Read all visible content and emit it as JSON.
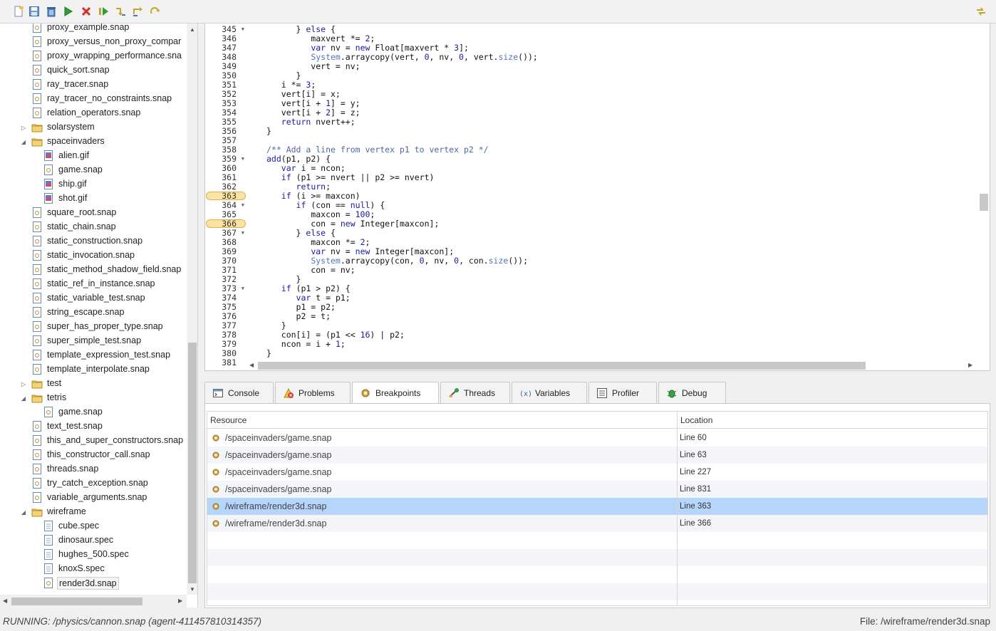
{
  "toolbar": {
    "buttons": [
      "new-file",
      "save",
      "delete",
      "run",
      "stop",
      "resume",
      "step-into",
      "step-over",
      "step-return"
    ],
    "right_button": "perspective"
  },
  "tree": {
    "items": [
      {
        "label": "proxy_example.snap",
        "type": "snap",
        "depth": 1
      },
      {
        "label": "proxy_versus_non_proxy_compar",
        "type": "snap",
        "depth": 1
      },
      {
        "label": "proxy_wrapping_performance.sna",
        "type": "snap",
        "depth": 1
      },
      {
        "label": "quick_sort.snap",
        "type": "snap",
        "depth": 1
      },
      {
        "label": "ray_tracer.snap",
        "type": "snap",
        "depth": 1
      },
      {
        "label": "ray_tracer_no_constraints.snap",
        "type": "snap",
        "depth": 1
      },
      {
        "label": "relation_operators.snap",
        "type": "snap",
        "depth": 1
      },
      {
        "label": "solarsystem",
        "type": "folder",
        "depth": 1,
        "expanded": false
      },
      {
        "label": "spaceinvaders",
        "type": "folder",
        "depth": 1,
        "expanded": true
      },
      {
        "label": "alien.gif",
        "type": "gif",
        "depth": 2
      },
      {
        "label": "game.snap",
        "type": "snap",
        "depth": 2
      },
      {
        "label": "ship.gif",
        "type": "gif",
        "depth": 2
      },
      {
        "label": "shot.gif",
        "type": "gif",
        "depth": 2
      },
      {
        "label": "square_root.snap",
        "type": "snap",
        "depth": 1
      },
      {
        "label": "static_chain.snap",
        "type": "snap",
        "depth": 1
      },
      {
        "label": "static_construction.snap",
        "type": "snap",
        "depth": 1
      },
      {
        "label": "static_invocation.snap",
        "type": "snap",
        "depth": 1
      },
      {
        "label": "static_method_shadow_field.snap",
        "type": "snap",
        "depth": 1
      },
      {
        "label": "static_ref_in_instance.snap",
        "type": "snap",
        "depth": 1
      },
      {
        "label": "static_variable_test.snap",
        "type": "snap",
        "depth": 1
      },
      {
        "label": "string_escape.snap",
        "type": "snap",
        "depth": 1
      },
      {
        "label": "super_has_proper_type.snap",
        "type": "snap",
        "depth": 1
      },
      {
        "label": "super_simple_test.snap",
        "type": "snap",
        "depth": 1
      },
      {
        "label": "template_expression_test.snap",
        "type": "snap",
        "depth": 1
      },
      {
        "label": "template_interpolate.snap",
        "type": "snap",
        "depth": 1
      },
      {
        "label": "test",
        "type": "folder",
        "depth": 1,
        "expanded": false
      },
      {
        "label": "tetris",
        "type": "folder",
        "depth": 1,
        "expanded": true
      },
      {
        "label": "game.snap",
        "type": "snap",
        "depth": 2
      },
      {
        "label": "text_test.snap",
        "type": "snap",
        "depth": 1
      },
      {
        "label": "this_and_super_constructors.snap",
        "type": "snap",
        "depth": 1
      },
      {
        "label": "this_constructor_call.snap",
        "type": "snap",
        "depth": 1
      },
      {
        "label": "threads.snap",
        "type": "snap",
        "depth": 1
      },
      {
        "label": "try_catch_exception.snap",
        "type": "snap",
        "depth": 1
      },
      {
        "label": "variable_arguments.snap",
        "type": "snap",
        "depth": 1
      },
      {
        "label": "wireframe",
        "type": "folder",
        "depth": 1,
        "expanded": true
      },
      {
        "label": "cube.spec",
        "type": "spec",
        "depth": 2
      },
      {
        "label": "dinosaur.spec",
        "type": "spec",
        "depth": 2
      },
      {
        "label": "hughes_500.spec",
        "type": "spec",
        "depth": 2
      },
      {
        "label": "knoxS.spec",
        "type": "spec",
        "depth": 2
      },
      {
        "label": "render3d.snap",
        "type": "snap",
        "depth": 2,
        "selected": true
      }
    ]
  },
  "editor": {
    "lines": [
      {
        "n": "345",
        "fold": true,
        "code": [
          [
            "",
            "      } "
          ],
          [
            "kw",
            "else"
          ],
          [
            "",
            " {"
          ]
        ]
      },
      {
        "n": "346",
        "code": [
          [
            "",
            "         maxvert *= "
          ],
          [
            "num2",
            "2"
          ],
          [
            "",
            ";"
          ]
        ]
      },
      {
        "n": "347",
        "code": [
          [
            "",
            "         "
          ],
          [
            "kw",
            "var"
          ],
          [
            "",
            " nv = "
          ],
          [
            "kw",
            "new"
          ],
          [
            "",
            " Float[maxvert * "
          ],
          [
            "num2",
            "3"
          ],
          [
            "",
            "];"
          ]
        ]
      },
      {
        "n": "348",
        "code": [
          [
            "",
            "         "
          ],
          [
            "sys",
            "System"
          ],
          [
            "",
            ".arraycopy(vert, "
          ],
          [
            "num2",
            "0"
          ],
          [
            "",
            ", nv, "
          ],
          [
            "num2",
            "0"
          ],
          [
            "",
            ", vert."
          ],
          [
            "sys",
            "size"
          ],
          [
            "",
            "());"
          ]
        ]
      },
      {
        "n": "349",
        "code": [
          [
            "",
            "         vert = nv;"
          ]
        ]
      },
      {
        "n": "350",
        "code": [
          [
            "",
            "      }"
          ]
        ]
      },
      {
        "n": "351",
        "code": [
          [
            "",
            "   i *= "
          ],
          [
            "num2",
            "3"
          ],
          [
            "",
            ";"
          ]
        ]
      },
      {
        "n": "352",
        "code": [
          [
            "",
            "   vert[i] = x;"
          ]
        ]
      },
      {
        "n": "353",
        "code": [
          [
            "",
            "   vert[i + "
          ],
          [
            "num2",
            "1"
          ],
          [
            "",
            "] = y;"
          ]
        ]
      },
      {
        "n": "354",
        "code": [
          [
            "",
            "   vert[i + "
          ],
          [
            "num2",
            "2"
          ],
          [
            "",
            "] = z;"
          ]
        ]
      },
      {
        "n": "355",
        "code": [
          [
            "",
            "   "
          ],
          [
            "kw",
            "return"
          ],
          [
            "",
            " nvert++;"
          ]
        ]
      },
      {
        "n": "356",
        "code": [
          [
            "",
            "}"
          ]
        ]
      },
      {
        "n": "357",
        "code": [
          [
            "",
            ""
          ]
        ]
      },
      {
        "n": "358",
        "code": [
          [
            "cm",
            "/** Add a line from vertex p1 to vertex p2 */"
          ]
        ]
      },
      {
        "n": "359",
        "fold": true,
        "code": [
          [
            "kw",
            "add"
          ],
          [
            "",
            "(p1, p2) {"
          ]
        ]
      },
      {
        "n": "360",
        "code": [
          [
            "",
            "   "
          ],
          [
            "kw",
            "var"
          ],
          [
            "",
            " i = ncon;"
          ]
        ]
      },
      {
        "n": "361",
        "code": [
          [
            "",
            "   "
          ],
          [
            "kw",
            "if"
          ],
          [
            "",
            " (p1 >= nvert || p2 >= nvert)"
          ]
        ]
      },
      {
        "n": "362",
        "code": [
          [
            "",
            "      "
          ],
          [
            "kw",
            "return"
          ],
          [
            "",
            ";"
          ]
        ]
      },
      {
        "n": "363",
        "bp": true,
        "code": [
          [
            "",
            "   "
          ],
          [
            "kw",
            "if"
          ],
          [
            "",
            " (i >= maxcon)"
          ]
        ]
      },
      {
        "n": "364",
        "fold": true,
        "code": [
          [
            "",
            "      "
          ],
          [
            "kw",
            "if"
          ],
          [
            "",
            " (con == "
          ],
          [
            "kw",
            "null"
          ],
          [
            "",
            ") {"
          ]
        ]
      },
      {
        "n": "365",
        "code": [
          [
            "",
            "         maxcon = "
          ],
          [
            "num2",
            "100"
          ],
          [
            "",
            ";"
          ]
        ]
      },
      {
        "n": "366",
        "bp": true,
        "code": [
          [
            "",
            "         con = "
          ],
          [
            "kw",
            "new"
          ],
          [
            "",
            " Integer[maxcon];"
          ]
        ]
      },
      {
        "n": "367",
        "fold": true,
        "code": [
          [
            "",
            "      } "
          ],
          [
            "kw",
            "else"
          ],
          [
            "",
            " {"
          ]
        ]
      },
      {
        "n": "368",
        "code": [
          [
            "",
            "         maxcon *= "
          ],
          [
            "num2",
            "2"
          ],
          [
            "",
            ";"
          ]
        ]
      },
      {
        "n": "369",
        "code": [
          [
            "",
            "         "
          ],
          [
            "kw",
            "var"
          ],
          [
            "",
            " nv = "
          ],
          [
            "kw",
            "new"
          ],
          [
            "",
            " Integer[maxcon];"
          ]
        ]
      },
      {
        "n": "370",
        "code": [
          [
            "",
            "         "
          ],
          [
            "sys",
            "System"
          ],
          [
            "",
            ".arraycopy(con, "
          ],
          [
            "num2",
            "0"
          ],
          [
            "",
            ", nv, "
          ],
          [
            "num2",
            "0"
          ],
          [
            "",
            ", con."
          ],
          [
            "sys",
            "size"
          ],
          [
            "",
            "());"
          ]
        ]
      },
      {
        "n": "371",
        "code": [
          [
            "",
            "         con = nv;"
          ]
        ]
      },
      {
        "n": "372",
        "code": [
          [
            "",
            "      }"
          ]
        ]
      },
      {
        "n": "373",
        "fold": true,
        "code": [
          [
            "",
            "   "
          ],
          [
            "kw",
            "if"
          ],
          [
            "",
            " (p1 > p2) {"
          ]
        ]
      },
      {
        "n": "374",
        "code": [
          [
            "",
            "      "
          ],
          [
            "kw",
            "var"
          ],
          [
            "",
            " t = p1;"
          ]
        ]
      },
      {
        "n": "375",
        "code": [
          [
            "",
            "      p1 = p2;"
          ]
        ]
      },
      {
        "n": "376",
        "code": [
          [
            "",
            "      p2 = t;"
          ]
        ]
      },
      {
        "n": "377",
        "code": [
          [
            "",
            "   }"
          ]
        ]
      },
      {
        "n": "378",
        "code": [
          [
            "",
            "   con[i] = (p1 << "
          ],
          [
            "num2",
            "16"
          ],
          [
            "",
            ") | p2;"
          ]
        ]
      },
      {
        "n": "379",
        "code": [
          [
            "",
            "   ncon = i + "
          ],
          [
            "num2",
            "1"
          ],
          [
            "",
            ";"
          ]
        ]
      },
      {
        "n": "380",
        "code": [
          [
            "",
            "}"
          ]
        ]
      },
      {
        "n": "381",
        "code": [
          [
            "",
            ""
          ]
        ]
      }
    ]
  },
  "tabs": [
    {
      "label": "Console",
      "icon": "console-icon"
    },
    {
      "label": "Problems",
      "icon": "problems-icon"
    },
    {
      "label": "Breakpoints",
      "icon": "breakpoints-icon",
      "active": true
    },
    {
      "label": "Threads",
      "icon": "threads-icon"
    },
    {
      "label": "Variables",
      "icon": "variables-icon"
    },
    {
      "label": "Profiler",
      "icon": "profiler-icon"
    },
    {
      "label": "Debug",
      "icon": "debug-icon"
    }
  ],
  "breakpoints": {
    "headers": {
      "resource": "Resource",
      "location": "Location"
    },
    "rows": [
      {
        "resource": "/spaceinvaders/game.snap",
        "location": "Line 60"
      },
      {
        "resource": "/spaceinvaders/game.snap",
        "location": "Line 63"
      },
      {
        "resource": "/spaceinvaders/game.snap",
        "location": "Line 227"
      },
      {
        "resource": "/spaceinvaders/game.snap",
        "location": "Line 831"
      },
      {
        "resource": "/wireframe/render3d.snap",
        "location": "Line 363",
        "selected": true
      },
      {
        "resource": "/wireframe/render3d.snap",
        "location": "Line 366"
      }
    ]
  },
  "status": {
    "left": "RUNNING: /physics/cannon.snap (agent-411457810314357)",
    "right": "File: /wireframe/render3d.snap"
  }
}
